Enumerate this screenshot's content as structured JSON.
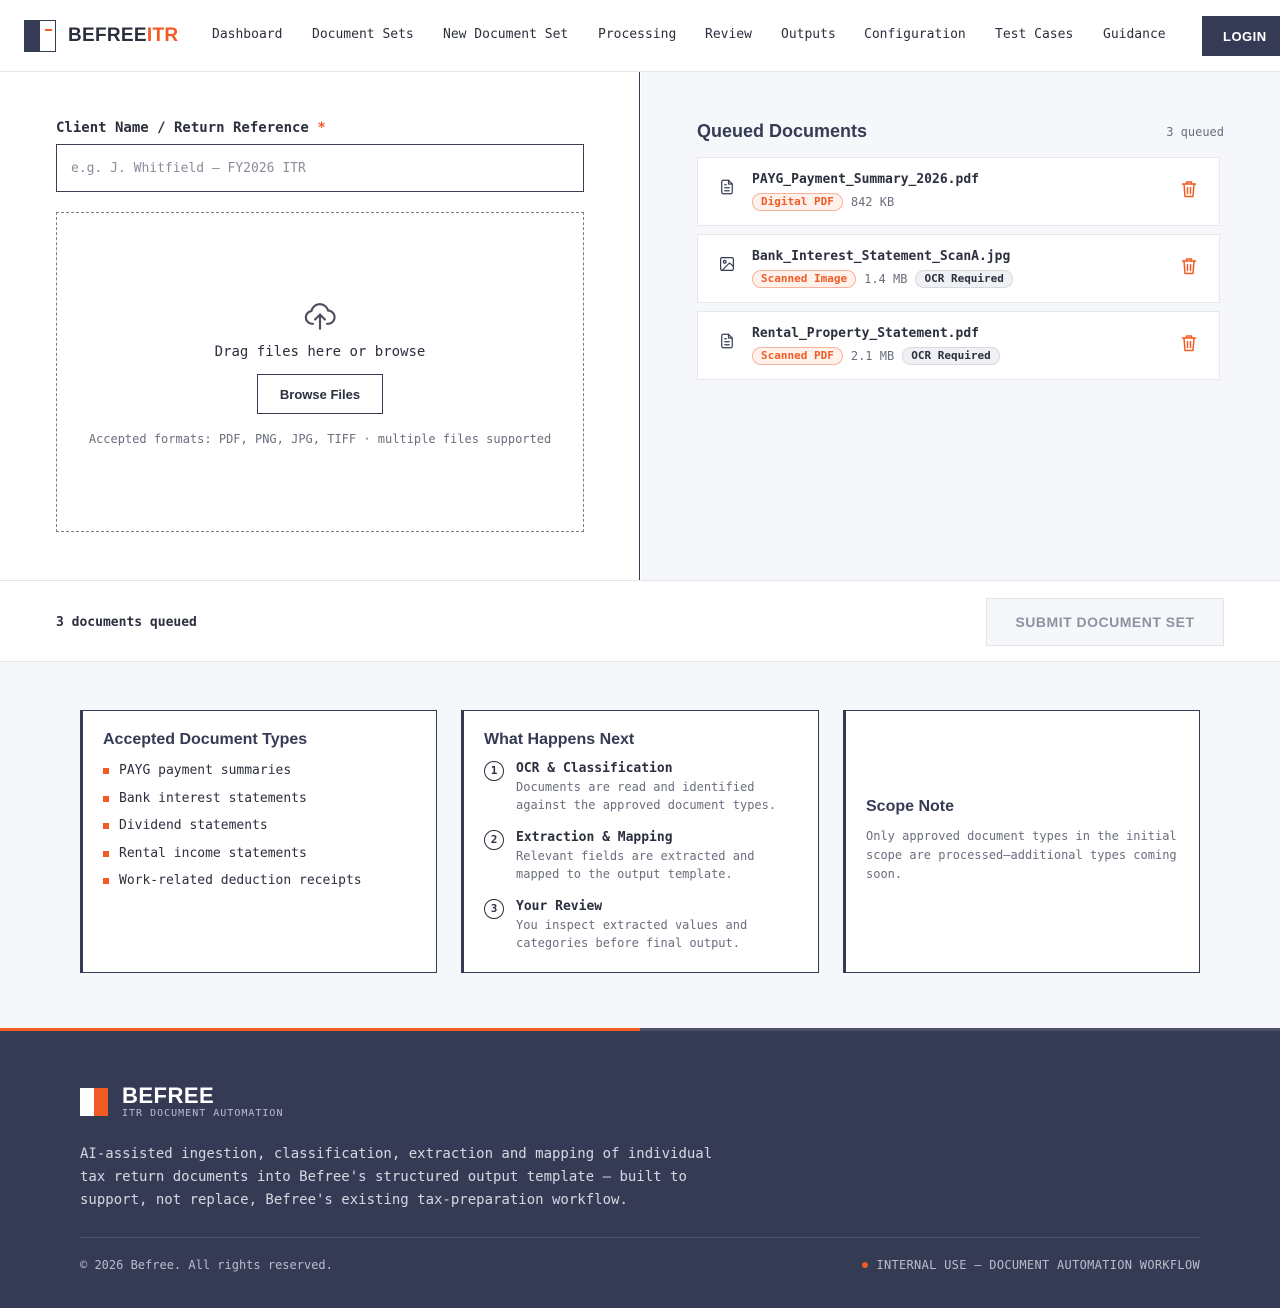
{
  "header": {
    "brand_main": "BEFREE",
    "brand_accent": "ITR",
    "nav": [
      "Dashboard",
      "Document Sets",
      "New Document Set",
      "Processing",
      "Review",
      "Outputs",
      "Configuration",
      "Test Cases",
      "Guidance"
    ],
    "login_label": "LOGIN"
  },
  "form": {
    "client_label": "Client Name / Return Reference",
    "required_mark": "*",
    "client_placeholder": "e.g. J. Whitfield — FY2026 ITR",
    "client_value": "",
    "drop_text": "Drag files here or browse",
    "browse_label": "Browse Files",
    "formats_text": "Accepted formats: PDF, PNG, JPG, TIFF · multiple files supported"
  },
  "queue": {
    "title": "Queued Documents",
    "count_label": "3 queued",
    "documents": [
      {
        "name": "PAYG_Payment_Summary_2026.pdf",
        "type": "Digital PDF",
        "size": "842 KB",
        "ocr": "",
        "icon": "file-text-icon"
      },
      {
        "name": "Bank_Interest_Statement_ScanA.jpg",
        "type": "Scanned Image",
        "size": "1.4 MB",
        "ocr": "OCR Required",
        "icon": "image-icon"
      },
      {
        "name": "Rental_Property_Statement.pdf",
        "type": "Scanned PDF",
        "size": "2.1 MB",
        "ocr": "OCR Required",
        "icon": "file-text-icon"
      }
    ]
  },
  "submit": {
    "summary": "3 documents queued",
    "button_label": "SUBMIT DOCUMENT SET"
  },
  "info": {
    "types": {
      "title": "Accepted Document Types",
      "items": [
        "PAYG payment summaries",
        "Bank interest statements",
        "Dividend statements",
        "Rental income statements",
        "Work-related deduction receipts"
      ]
    },
    "next": {
      "title": "What Happens Next",
      "steps": [
        {
          "num": "1",
          "title": "OCR & Classification",
          "desc": "Documents are read and identified against the approved document types."
        },
        {
          "num": "2",
          "title": "Extraction & Mapping",
          "desc": "Relevant fields are extracted and mapped to the output template."
        },
        {
          "num": "3",
          "title": "Your Review",
          "desc": "You inspect extracted values and categories before final output."
        }
      ]
    },
    "scope": {
      "title": "Scope Note",
      "text": "Only approved document types in the initial scope are processed—additional types coming soon."
    }
  },
  "footer": {
    "brand": "BEFREE",
    "tagline": "ITR DOCUMENT AUTOMATION",
    "description": "AI-assisted ingestion, classification, extraction and mapping of individual tax return documents into Befree's structured output template — built to support, not replace, Befree's existing tax-preparation workflow.",
    "copyright": "© 2026 Befree. All rights reserved.",
    "internal": "INTERNAL USE — DOCUMENT AUTOMATION WORKFLOW"
  },
  "colors": {
    "accent": "#f25c24",
    "navy": "#363b55",
    "panel_bg": "#f6f7fa"
  }
}
